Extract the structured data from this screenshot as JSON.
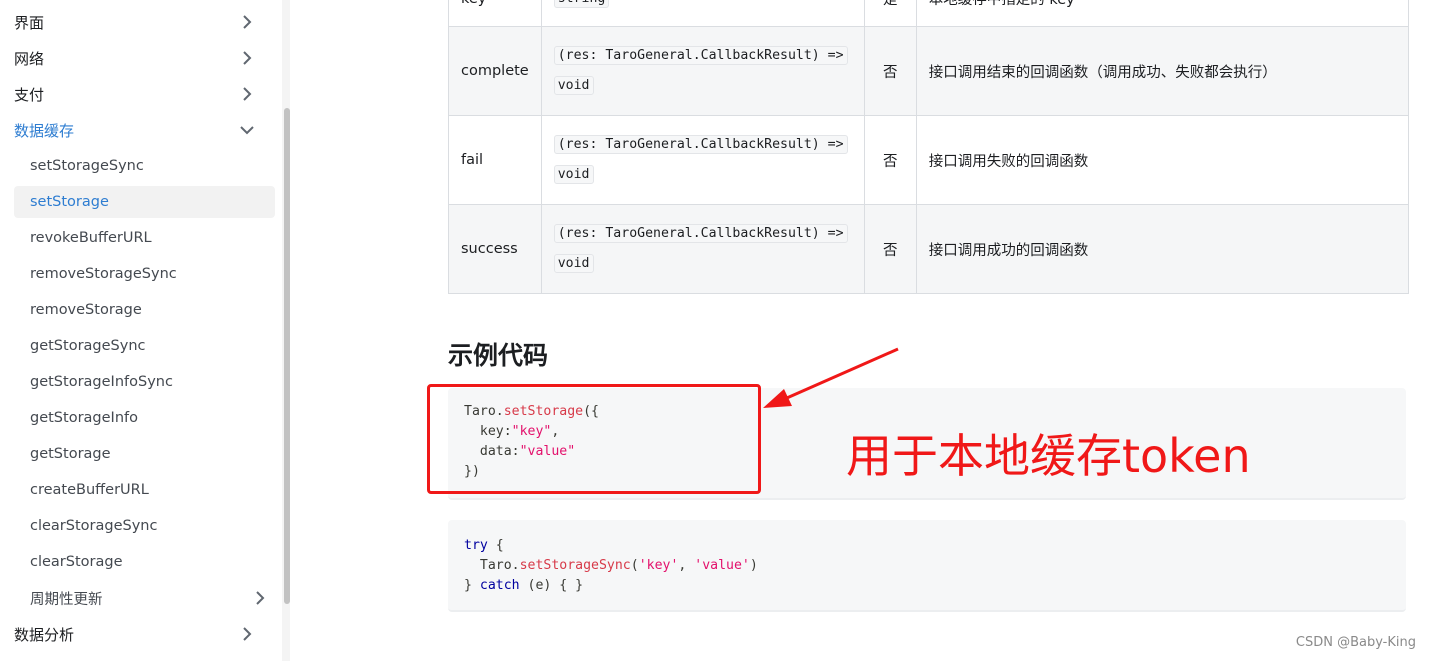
{
  "sidebar": {
    "categories": [
      {
        "label": "界面",
        "expanded": false
      },
      {
        "label": "网络",
        "expanded": false
      },
      {
        "label": "支付",
        "expanded": false
      },
      {
        "label": "数据缓存",
        "expanded": true
      },
      {
        "label": "数据分析",
        "expanded": false
      }
    ],
    "items": [
      {
        "label": "setStorageSync"
      },
      {
        "label": "setStorage",
        "active": true
      },
      {
        "label": "revokeBufferURL"
      },
      {
        "label": "removeStorageSync"
      },
      {
        "label": "removeStorage"
      },
      {
        "label": "getStorageSync"
      },
      {
        "label": "getStorageInfoSync"
      },
      {
        "label": "getStorageInfo"
      },
      {
        "label": "getStorage"
      },
      {
        "label": "createBufferURL"
      },
      {
        "label": "clearStorageSync"
      },
      {
        "label": "clearStorage"
      },
      {
        "label": "周期性更新",
        "has_children": true
      }
    ]
  },
  "params_table": {
    "rows": [
      {
        "name": "key",
        "type": "string",
        "required": "是",
        "desc": "本地缓存中指定的 key"
      },
      {
        "name": "complete",
        "type_line1": "(res: TaroGeneral.CallbackResult) =>",
        "type_line2": "void",
        "required": "否",
        "desc": "接口调用结束的回调函数（调用成功、失败都会执行）"
      },
      {
        "name": "fail",
        "type_line1": "(res: TaroGeneral.CallbackResult) =>",
        "type_line2": "void",
        "required": "否",
        "desc": "接口调用失败的回调函数"
      },
      {
        "name": "success",
        "type_line1": "(res: TaroGeneral.CallbackResult) =>",
        "type_line2": "void",
        "required": "否",
        "desc": "接口调用成功的回调函数"
      }
    ]
  },
  "section_heading": "示例代码",
  "code_example_1": {
    "obj": "Taro.",
    "fn": "setStorage",
    "open": "({",
    "key_label": "  key:",
    "key_value": "\"key\"",
    "comma": ",",
    "data_label": "  data:",
    "data_value": "\"value\"",
    "close": "})"
  },
  "code_example_2": {
    "try_kw": "try",
    "try_rest": " {",
    "obj": "  Taro.",
    "fn": "setStorageSync",
    "paren_open": "(",
    "arg1": "'key'",
    "sep": ", ",
    "arg2": "'value'",
    "paren_close": ")",
    "close_brace": "} ",
    "catch_kw": "catch",
    "catch_rest": " (e) { }"
  },
  "annotation_text": "用于本地缓存token",
  "watermark": "CSDN @Baby-King",
  "colors": {
    "accent": "#2e7dd1",
    "annotation_red": "#f01818"
  }
}
